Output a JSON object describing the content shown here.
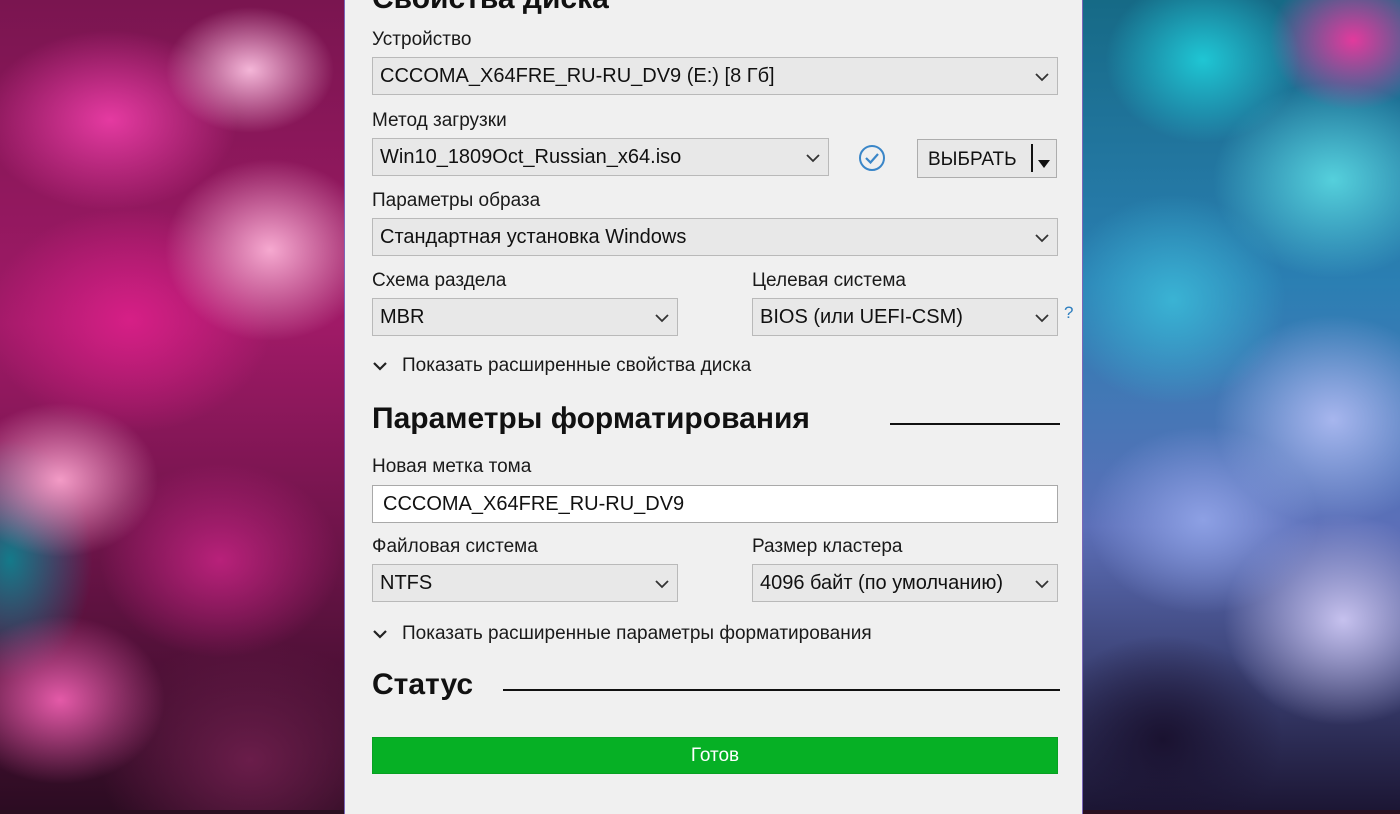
{
  "disk_properties": {
    "title": "Свойства диска",
    "device": {
      "label": "Устройство",
      "value": "CCCOMA_X64FRE_RU-RU_DV9 (E:) [8 Гб]"
    },
    "boot_selection": {
      "label": "Метод загрузки",
      "value": "Win10_1809Oct_Russian_x64.iso",
      "select_button": "ВЫБРАТЬ"
    },
    "image_option": {
      "label": "Параметры образа",
      "value": "Стандартная установка Windows"
    },
    "partition_scheme": {
      "label": "Схема раздела",
      "value": "MBR"
    },
    "target_system": {
      "label": "Целевая система",
      "value": "BIOS (или UEFI-CSM)",
      "help": "?"
    },
    "advanced_toggle": "Показать расширенные свойства диска"
  },
  "format_options": {
    "title": "Параметры форматирования",
    "volume_label": {
      "label": "Новая метка тома",
      "value": "CCCOMA_X64FRE_RU-RU_DV9"
    },
    "file_system": {
      "label": "Файловая система",
      "value": "NTFS"
    },
    "cluster_size": {
      "label": "Размер кластера",
      "value": "4096 байт (по умолчанию)"
    },
    "advanced_toggle": "Показать расширенные параметры форматирования"
  },
  "status": {
    "title": "Статус",
    "text": "Готов",
    "progress": 1.0,
    "bar_color": "#06b025"
  },
  "icons": {
    "verify": "check-circle-icon",
    "dropdown": "chevron-down-icon",
    "toggle": "chevron-down-icon"
  }
}
